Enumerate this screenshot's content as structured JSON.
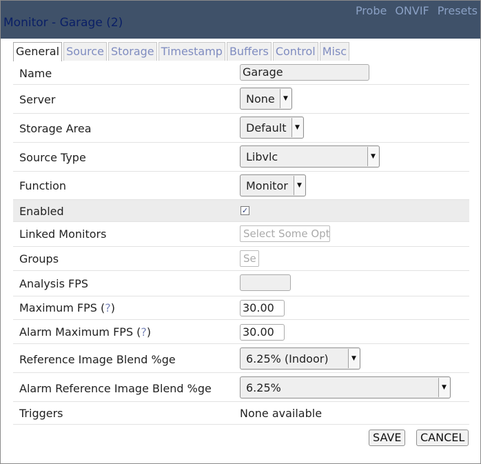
{
  "window": {
    "title": "Monitor - Garage (2)",
    "links": [
      "Probe",
      "ONVIF",
      "Presets"
    ]
  },
  "tabs": [
    "General",
    "Source",
    "Storage",
    "Timestamp",
    "Buffers",
    "Control",
    "Misc"
  ],
  "active_tab": "General",
  "fields": {
    "name": {
      "label": "Name",
      "value": "Garage"
    },
    "server": {
      "label": "Server",
      "value": "None"
    },
    "storage_area": {
      "label": "Storage Area",
      "value": "Default"
    },
    "source_type": {
      "label": "Source Type",
      "value": "Libvlc"
    },
    "function": {
      "label": "Function",
      "value": "Monitor"
    },
    "enabled": {
      "label": "Enabled",
      "checked": true,
      "check_glyph": "✓"
    },
    "linked_monitors": {
      "label": "Linked Monitors",
      "placeholder": "Select Some Opt"
    },
    "groups": {
      "label": "Groups",
      "placeholder": "Se"
    },
    "analysis_fps": {
      "label": "Analysis FPS",
      "value": ""
    },
    "max_fps": {
      "label": "Maximum FPS (",
      "help": "?",
      "label_end": ")",
      "value": "30.00"
    },
    "alarm_max_fps": {
      "label": "Alarm Maximum FPS (",
      "help": "?",
      "label_end": ")",
      "value": "30.00"
    },
    "ref_blend": {
      "label": "Reference Image Blend %ge",
      "value": "6.25% (Indoor)"
    },
    "alarm_ref_blend": {
      "label": "Alarm Reference Image Blend %ge",
      "value": "6.25%"
    },
    "triggers": {
      "label": "Triggers",
      "value": "None available"
    }
  },
  "buttons": {
    "save": "SAVE",
    "cancel": "CANCEL"
  },
  "icons": {
    "dropdown": "chevron-down-icon",
    "checkbox": "checkmark-icon"
  }
}
